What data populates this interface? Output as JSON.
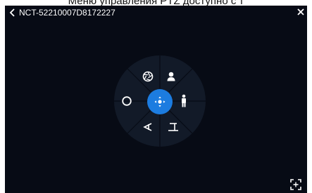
{
  "banner": {
    "text": "Меню управления PTZ доступно с т"
  },
  "topbar": {
    "device_id": "NCT-52210007D8172227"
  },
  "ptz_menu": {
    "items": [
      {
        "icon": "aperture-icon"
      },
      {
        "icon": "person-head-icon"
      },
      {
        "icon": "person-full-icon"
      },
      {
        "icon": "focus-near-icon"
      },
      {
        "icon": "focus-far-icon"
      },
      {
        "icon": "circle-icon"
      },
      {
        "icon": "move-arrows-icon"
      }
    ],
    "joystick_color": "#1c7ce0"
  },
  "colors": {
    "background": "#070b15",
    "ring": "#121a28",
    "icon": "#ffffff"
  }
}
